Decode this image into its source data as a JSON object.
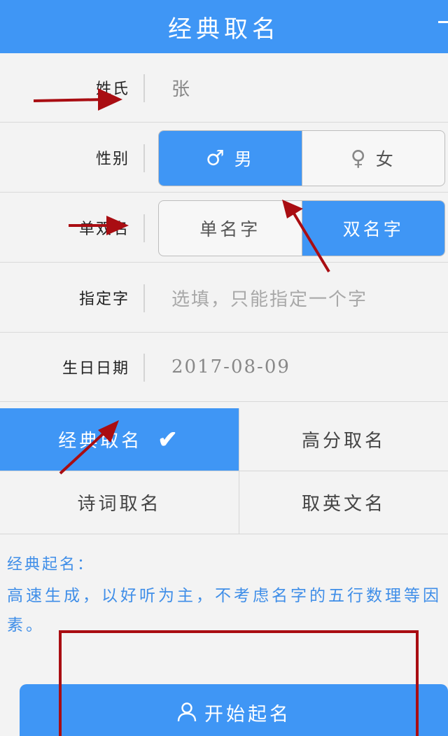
{
  "header": {
    "title": "经典取名"
  },
  "form": {
    "surname": {
      "label": "姓氏",
      "value": "张"
    },
    "gender": {
      "label": "性别",
      "male_symbol": "♂",
      "male": "男",
      "female_symbol": "♀",
      "female": "女",
      "selected": "男"
    },
    "name_length": {
      "label": "单双名",
      "single": "单名字",
      "double": "双名字",
      "selected": "双名字"
    },
    "specified_char": {
      "label": "指定字",
      "placeholder": "选填，只能指定一个字"
    },
    "birthday": {
      "label": "生日日期",
      "value": "2017-08-09"
    }
  },
  "modes": {
    "items": [
      "经典取名",
      "高分取名",
      "诗词取名",
      "取英文名"
    ],
    "selected": "经典取名",
    "check_mark": "✔"
  },
  "description": {
    "title": "经典起名：",
    "text": "高速生成，以好听为主，不考虑名字的五行数理等因素。"
  },
  "start_button": {
    "label": "开始起名",
    "icon": "user-icon"
  },
  "colors": {
    "primary": "#3f96f5",
    "annotation": "#a90d12",
    "desc_text": "#3f8ee8"
  }
}
